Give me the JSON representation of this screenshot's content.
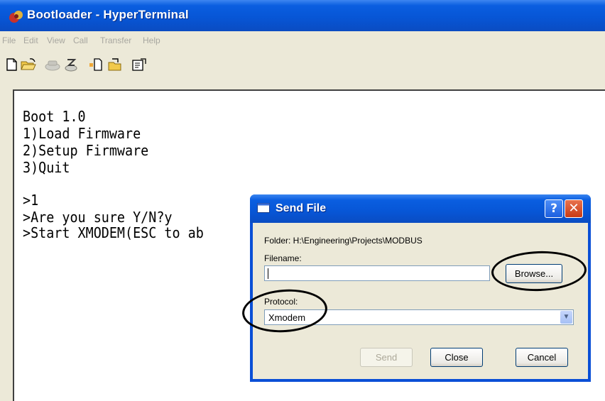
{
  "window": {
    "title": "Bootloader - HyperTerminal",
    "menu": [
      "File",
      "Edit",
      "View",
      "Call",
      "Transfer",
      "Help"
    ],
    "toolbar_icons": [
      "new-icon",
      "open-icon",
      "disconnect-icon",
      "dial-icon",
      "send-icon",
      "receive-icon",
      "properties-icon"
    ]
  },
  "terminal": {
    "lines": [
      "Boot 1.0",
      "1)Load Firmware",
      "2)Setup Firmware",
      "3)Quit",
      "",
      ">1",
      ">Are you sure Y/N?y",
      ">Start XMODEM(ESC to ab"
    ]
  },
  "dialog": {
    "title": "Send File",
    "help_label": "?",
    "close_label": "✕",
    "folder_text": "Folder: H:\\Engineering\\Projects\\MODBUS",
    "filename_label": "Filename:",
    "filename_value": "",
    "browse_label": "Browse...",
    "protocol_label": "Protocol:",
    "protocol_value": "Xmodem",
    "send_label": "Send",
    "close_button_label": "Close",
    "cancel_label": "Cancel"
  },
  "colors": {
    "titlebar": "#0756d6",
    "window_face": "#ece9d8",
    "annotation": "#000000"
  }
}
